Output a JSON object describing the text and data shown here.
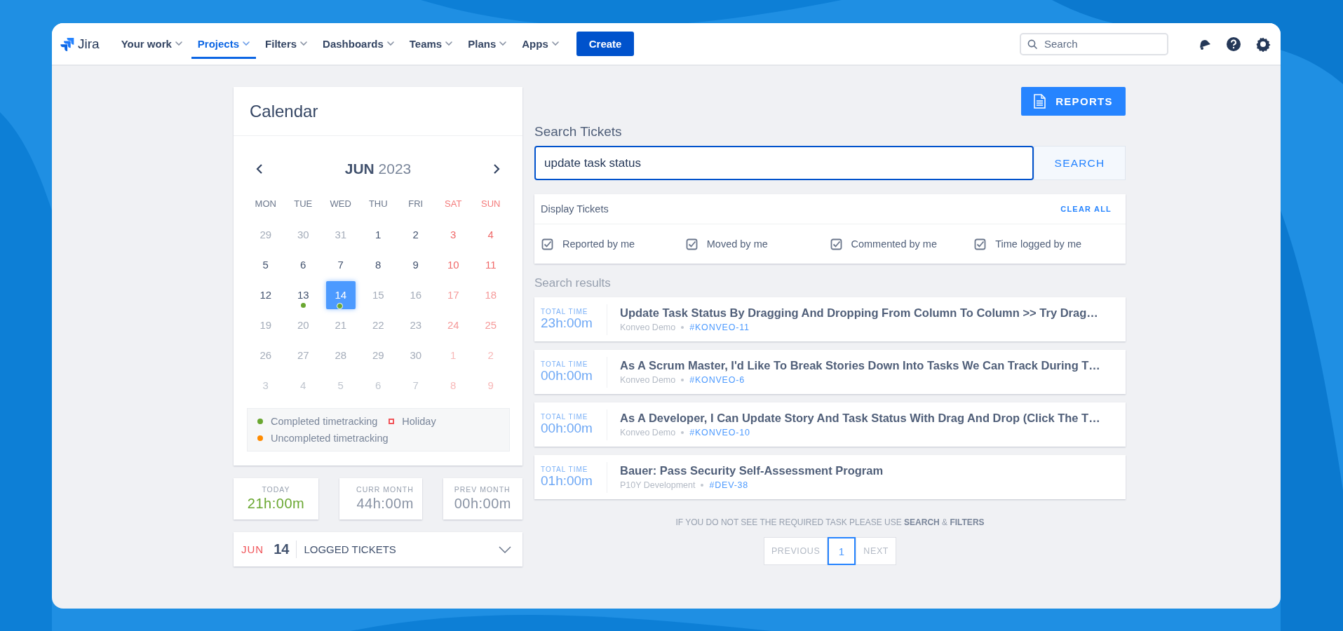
{
  "nav": {
    "logo": "Jira",
    "items": [
      {
        "label": "Your work",
        "selected": false
      },
      {
        "label": "Projects",
        "selected": true
      },
      {
        "label": "Filters",
        "selected": false
      },
      {
        "label": "Dashboards",
        "selected": false
      },
      {
        "label": "Teams",
        "selected": false
      },
      {
        "label": "Plans",
        "selected": false
      },
      {
        "label": "Apps",
        "selected": false
      }
    ],
    "create_button": "Create",
    "search": {
      "placeholder": "Search"
    }
  },
  "calendar": {
    "title": "Calendar",
    "month": "JUN",
    "year": "2023",
    "weekdays": [
      {
        "label": "MON",
        "weekend": false
      },
      {
        "label": "TUE",
        "weekend": false
      },
      {
        "label": "WED",
        "weekend": false
      },
      {
        "label": "THU",
        "weekend": false
      },
      {
        "label": "FRI",
        "weekend": false
      },
      {
        "label": "SAT",
        "weekend": true
      },
      {
        "label": "SUN",
        "weekend": true
      }
    ],
    "days": [
      {
        "day": "29",
        "disabled": true,
        "next_month": false,
        "selected": false
      },
      {
        "day": "30",
        "disabled": true,
        "next_month": false,
        "selected": false
      },
      {
        "day": "31",
        "disabled": true,
        "next_month": false,
        "selected": false
      },
      {
        "day": "1",
        "disabled": false,
        "next_month": false,
        "selected": false
      },
      {
        "day": "2",
        "disabled": false,
        "next_month": false,
        "selected": false
      },
      {
        "day": "3",
        "disabled": false,
        "next_month": false,
        "selected": false
      },
      {
        "day": "4",
        "disabled": false,
        "next_month": false,
        "selected": false
      },
      {
        "day": "5",
        "disabled": false,
        "next_month": false,
        "selected": false
      },
      {
        "day": "6",
        "disabled": false,
        "next_month": false,
        "selected": false
      },
      {
        "day": "7",
        "disabled": false,
        "next_month": false,
        "selected": false
      },
      {
        "day": "8",
        "disabled": false,
        "next_month": false,
        "selected": false
      },
      {
        "day": "9",
        "disabled": false,
        "next_month": false,
        "selected": false
      },
      {
        "day": "10",
        "disabled": false,
        "next_month": false,
        "selected": false
      },
      {
        "day": "11",
        "disabled": false,
        "next_month": false,
        "selected": false
      },
      {
        "day": "12",
        "disabled": false,
        "next_month": false,
        "selected": false
      },
      {
        "day": "13",
        "disabled": false,
        "next_month": false,
        "selected": false,
        "color": "#6aa731"
      },
      {
        "day": "14",
        "disabled": false,
        "next_month": false,
        "selected": true,
        "color": "#6aa731"
      },
      {
        "day": "15",
        "disabled": true,
        "next_month": false,
        "selected": false
      },
      {
        "day": "16",
        "disabled": true,
        "next_month": false,
        "selected": false
      },
      {
        "day": "17",
        "disabled": true,
        "next_month": false,
        "selected": false
      },
      {
        "day": "18",
        "disabled": true,
        "next_month": false,
        "selected": false
      },
      {
        "day": "19",
        "disabled": true,
        "next_month": false,
        "selected": false
      },
      {
        "day": "20",
        "disabled": true,
        "next_month": false,
        "selected": false
      },
      {
        "day": "21",
        "disabled": true,
        "next_month": false,
        "selected": false
      },
      {
        "day": "22",
        "disabled": true,
        "next_month": false,
        "selected": false
      },
      {
        "day": "23",
        "disabled": true,
        "next_month": false,
        "selected": false
      },
      {
        "day": "24",
        "disabled": true,
        "next_month": false,
        "selected": false
      },
      {
        "day": "25",
        "disabled": true,
        "next_month": false,
        "selected": false
      },
      {
        "day": "26",
        "disabled": true,
        "next_month": false,
        "selected": false
      },
      {
        "day": "27",
        "disabled": true,
        "next_month": false,
        "selected": false
      },
      {
        "day": "28",
        "disabled": true,
        "next_month": false,
        "selected": false
      },
      {
        "day": "29",
        "disabled": true,
        "next_month": false,
        "selected": false
      },
      {
        "day": "30",
        "disabled": true,
        "next_month": false,
        "selected": false
      },
      {
        "day": "1",
        "disabled": true,
        "next_month": true,
        "selected": false
      },
      {
        "day": "2",
        "disabled": true,
        "next_month": true,
        "selected": false
      },
      {
        "day": "3",
        "disabled": true,
        "next_month": true,
        "selected": false
      },
      {
        "day": "4",
        "disabled": true,
        "next_month": true,
        "selected": false
      },
      {
        "day": "5",
        "disabled": true,
        "next_month": true,
        "selected": false
      },
      {
        "day": "6",
        "disabled": true,
        "next_month": true,
        "selected": false
      },
      {
        "day": "7",
        "disabled": true,
        "next_month": true,
        "selected": false
      },
      {
        "day": "8",
        "disabled": true,
        "next_month": true,
        "selected": false
      },
      {
        "day": "9",
        "disabled": true,
        "next_month": true,
        "selected": false
      }
    ],
    "legend": [
      {
        "kind": "dot",
        "color": "#6aa731",
        "label": "Completed timetracking"
      },
      {
        "kind": "square",
        "color": "#f0555a",
        "label": "Holiday"
      },
      {
        "kind": "dot",
        "color": "#ff8b00",
        "label": "Uncompleted timetracking"
      }
    ]
  },
  "stats": [
    {
      "label": "TODAY",
      "value": "21h:00m",
      "color": "#6aa731"
    },
    {
      "label": "CURR MONTH",
      "value": "44h:00m",
      "color": "#8993a4"
    },
    {
      "label": "PREV MONTH",
      "value": "00h:00m",
      "color": "#8993a4"
    }
  ],
  "logged_tickets": {
    "month": "JUN",
    "day": "14",
    "label": "LOGGED TICKETS",
    "expanded": false
  },
  "reports_button": "REPORTS",
  "search": {
    "title": "Search Tickets",
    "value": "update task status",
    "button": "SEARCH"
  },
  "display_tickets": {
    "title": "Display Tickets",
    "clear_all": "CLEAR ALL",
    "filters": [
      {
        "label": "Reported by me",
        "checked": true
      },
      {
        "label": "Moved by me",
        "checked": true
      },
      {
        "label": "Commented by me",
        "checked": true
      },
      {
        "label": "Time logged by me",
        "checked": true
      }
    ]
  },
  "results": {
    "title": "Search results",
    "items": [
      {
        "time_label": "TOTAL TIME",
        "time": "23h:00m",
        "title": "Update Task Status By Dragging And Dropping From Column To Column >> Try Drag…",
        "project": "Konveo Demo",
        "key": "#KONVEO-11"
      },
      {
        "time_label": "TOTAL TIME",
        "time": "00h:00m",
        "title": "As A Scrum Master, I'd Like To Break Stories Down Into Tasks We Can Track During T…",
        "project": "Konveo Demo",
        "key": "#KONVEO-6"
      },
      {
        "time_label": "TOTAL TIME",
        "time": "00h:00m",
        "title": "As A Developer, I Can Update Story And Task Status With Drag And Drop (Click The T…",
        "project": "Konveo Demo",
        "key": "#KONVEO-10"
      },
      {
        "time_label": "TOTAL TIME",
        "time": "01h:00m",
        "title": "Bauer: Pass Security Self-Assessment Program",
        "project": "P10Y Development",
        "key": "#DEV-38"
      }
    ]
  },
  "hint": "IF YOU DO NOT SEE THE REQUIRED TASK PLEASE USE **SEARCH** & **FILTERS**",
  "pagination": {
    "previous": "PREVIOUS",
    "pages": [
      {
        "label": "1",
        "selected": true
      }
    ],
    "next": "NEXT"
  }
}
